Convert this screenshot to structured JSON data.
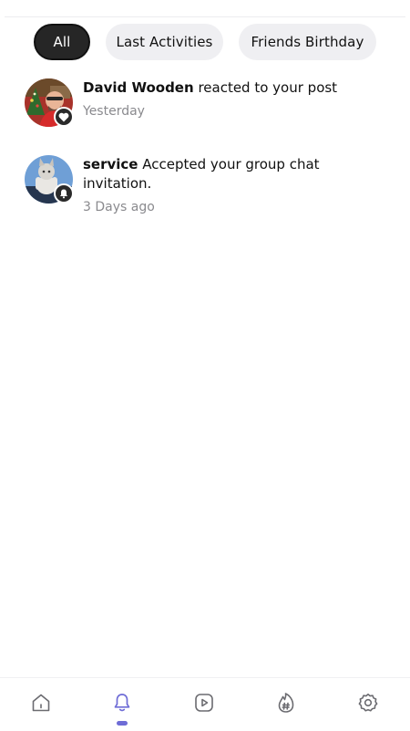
{
  "filters": {
    "items": [
      {
        "label": "All",
        "active": true
      },
      {
        "label": "Last Activities",
        "active": false
      },
      {
        "label": "Friends Birthday",
        "active": false
      }
    ]
  },
  "notifications": [
    {
      "name": "David Wooden",
      "message": " reacted to your post",
      "time": "Yesterday",
      "badge_icon": "heart-icon"
    },
    {
      "name": "service",
      "message": " Accepted your group chat invitation.",
      "time": "3 Days ago",
      "badge_icon": "bell-icon"
    }
  ],
  "bottom_nav": {
    "items": [
      "home-icon",
      "bell-icon",
      "play-icon",
      "hashtag-fire-icon",
      "gear-icon"
    ],
    "active": "bell-icon",
    "accent_color": "#6e6cd6",
    "inactive_color": "#6b6b70"
  }
}
